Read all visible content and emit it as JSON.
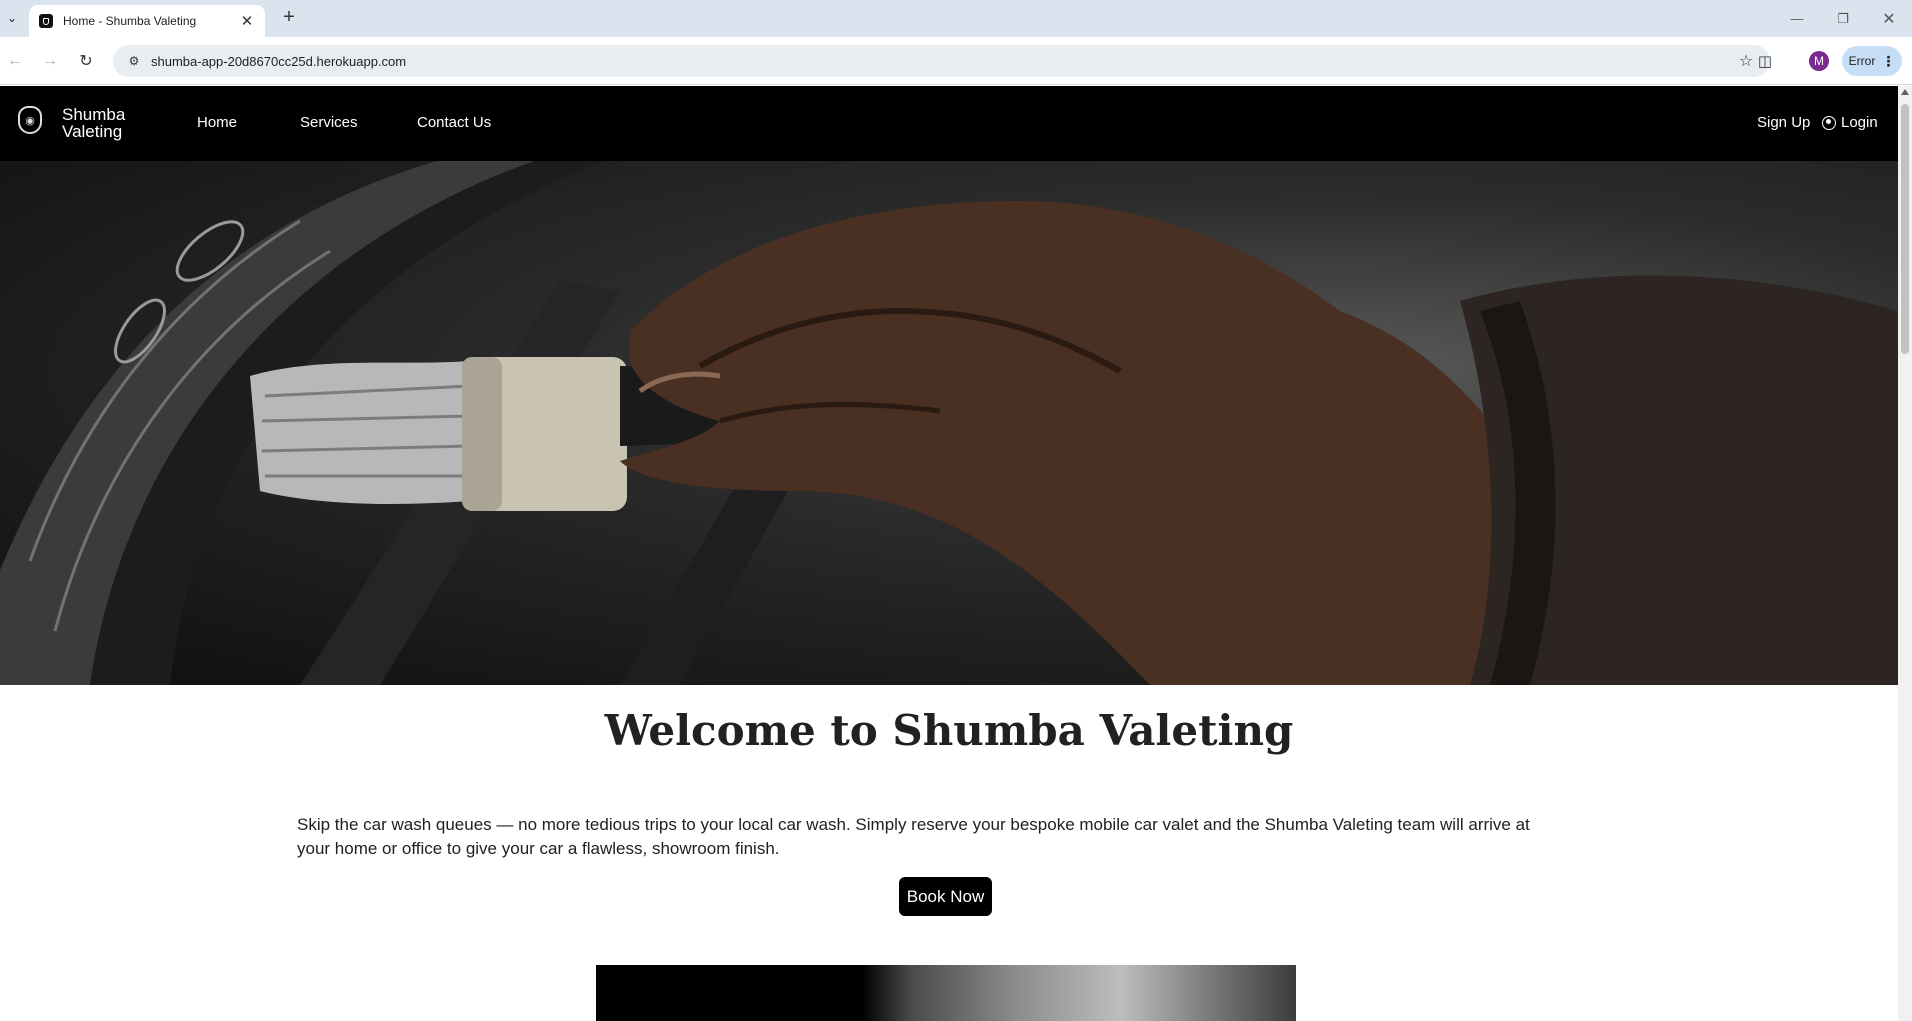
{
  "browser": {
    "tab_title": "Home - Shumba Valeting",
    "url": "shumba-app-20d8670cc25d.herokuapp.com",
    "profile_initial": "M",
    "error_label": "Error"
  },
  "site": {
    "brand": "Shumba Valeting",
    "nav": {
      "home": "Home",
      "services": "Services",
      "contact": "Contact Us",
      "signup": "Sign Up",
      "login": "Login"
    },
    "welcome_title": "Welcome to Shumba Valeting",
    "intro_text": "Skip the car wash queues — no more tedious trips to your local car wash. Simply reserve your bespoke mobile car valet and the Shumba Valeting team will arrive at your home or office to give your car a flawless, showroom finish.",
    "book_button": "Book Now"
  },
  "colors": {
    "nav_bg": "#000000",
    "tabbar_bg": "#d9e4ef",
    "omnibox_bg": "#e8edf2",
    "button_bg": "#000000"
  },
  "icons": [
    "shield-favicon-icon",
    "plus-icon",
    "back-arrow-icon",
    "forward-arrow-icon",
    "reload-icon",
    "site-info-icon",
    "star-icon",
    "extensions-icon",
    "kebab-menu-icon",
    "lion-logo-icon",
    "user-circle-icon"
  ]
}
